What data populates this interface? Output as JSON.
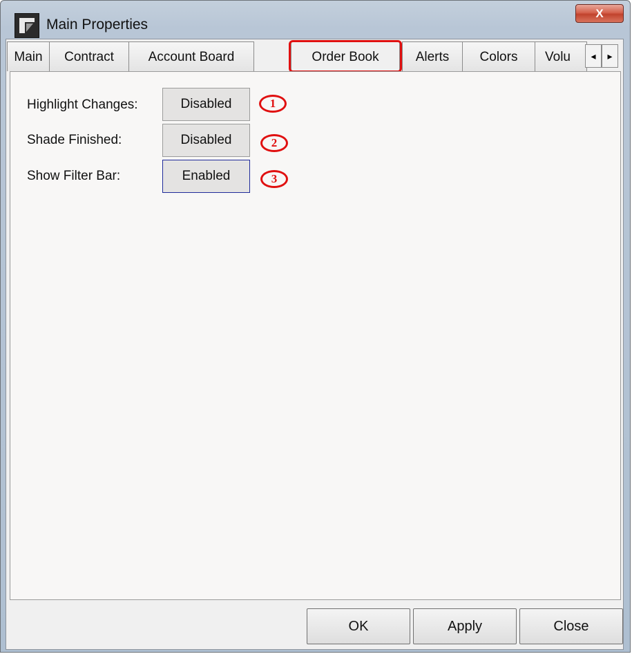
{
  "window": {
    "title": "Main Properties",
    "close_glyph": "X"
  },
  "tabs": [
    {
      "label": "Main"
    },
    {
      "label": "Contract"
    },
    {
      "label": "Account Board"
    },
    {
      "label": "Order Book"
    },
    {
      "label": "Alerts"
    },
    {
      "label": "Colors"
    },
    {
      "label": "Volu"
    }
  ],
  "active_tab": "Order Book",
  "tab_scroll": {
    "left_glyph": "◂",
    "right_glyph": "▸"
  },
  "settings": [
    {
      "label": "Highlight Changes:",
      "value": "Disabled",
      "marker": "1"
    },
    {
      "label": "Shade Finished:",
      "value": "Disabled",
      "marker": "2"
    },
    {
      "label": "Show Filter Bar:",
      "value": "Enabled",
      "marker": "3"
    }
  ],
  "footer": {
    "ok_label": "OK",
    "apply_label": "Apply",
    "close_label": "Close"
  },
  "colors": {
    "annotation_red": "#e01010",
    "focus_blue": "#1f2a9a"
  }
}
